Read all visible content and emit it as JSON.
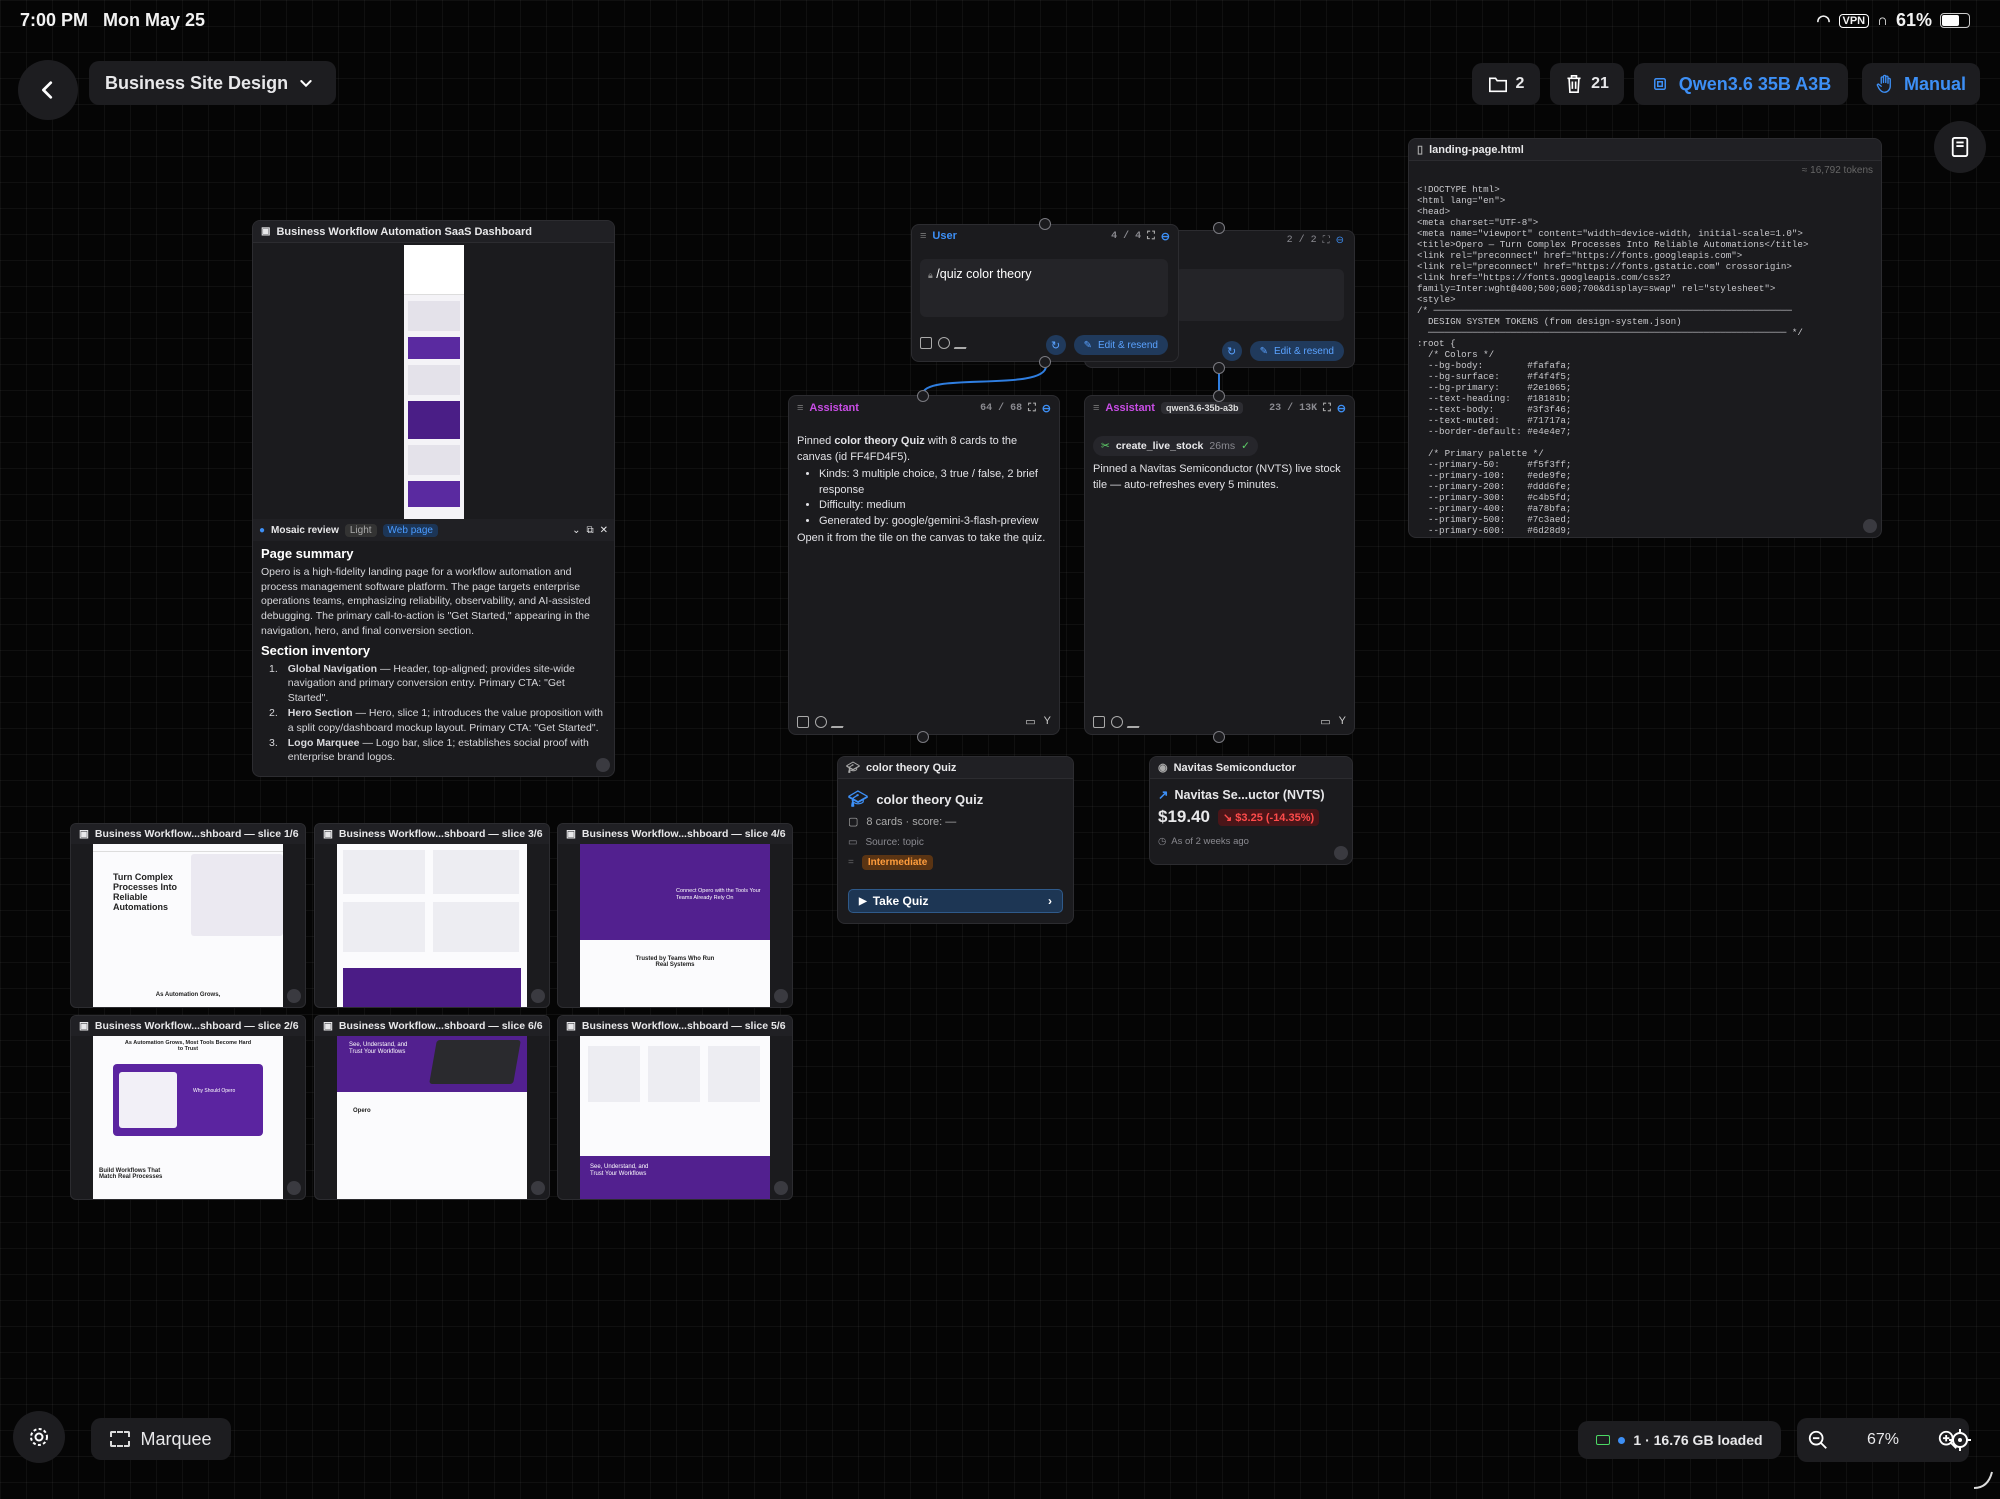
{
  "status": {
    "time": "7:00 PM",
    "date": "Mon May 25",
    "vpn": "VPN",
    "battery": "61%"
  },
  "topbar": {
    "project": "Business Site Design",
    "folders": "2",
    "trash": "21",
    "model": "Qwen3.6 35B A3B",
    "mode": "Manual"
  },
  "review": {
    "title": "Business Workflow Automation SaaS Dashboard",
    "badge": "Mosaic review",
    "tag1": "Light",
    "tag2": "Web page",
    "summary_h": "Page summary",
    "summary": "Opero is a high-fidelity landing page for a workflow automation and process management software platform. The page targets enterprise operations teams, emphasizing reliability, observability, and AI-assisted debugging. The primary call-to-action is \"Get Started,\" appearing in the navigation, hero, and final conversion section.",
    "inventory_h": "Section inventory",
    "items": [
      {
        "n": "1.",
        "b": "Global Navigation",
        "t": " — Header, top-aligned; provides site-wide navigation and primary conversion entry. Primary CTA: \"Get Started\"."
      },
      {
        "n": "2.",
        "b": "Hero Section",
        "t": " — Hero, slice 1; introduces the value proposition with a split copy/dashboard mockup layout. Primary CTA: \"Get Started\"."
      },
      {
        "n": "3.",
        "b": "Logo Marquee",
        "t": " — Logo bar, slice 1; establishes social proof with enterprise brand logos."
      }
    ]
  },
  "user_msg": {
    "role": "User",
    "count": "4 / 4",
    "text": "/quiz color theory",
    "edit": "Edit & resend",
    "count2": "2 / 2",
    "edit2": "Edit & resend"
  },
  "assistant1": {
    "role": "Assistant",
    "tokens": "64 / 68",
    "p1a": "Pinned ",
    "p1b": "color theory Quiz",
    "p1c": " with 8 cards to the canvas (id FF4FD4F5).",
    "bullets": [
      "Kinds: 3 multiple choice, 3 true / false, 2 brief response",
      "Difficulty: medium",
      "Generated by: google/gemini-3-flash-preview"
    ],
    "p2": "Open it from the tile on the canvas to take the quiz."
  },
  "assistant2": {
    "role": "Assistant",
    "model": "qwen3.6-35b-a3b",
    "tokens": "23 / 13K",
    "tool": "create_live_stock",
    "ms": "26ms",
    "text": "Pinned a Navitas Semiconductor (NVTS) live stock tile — auto-refreshes every 5 minutes."
  },
  "quiz": {
    "header": "color theory Quiz",
    "title": "color theory Quiz",
    "cards": "8 cards · score: —",
    "source": "Source: topic",
    "level": "Intermediate",
    "cta": "Take Quiz"
  },
  "stock": {
    "header": "Navitas Semiconductor",
    "name": "Navitas Se...uctor (NVTS)",
    "price": "$19.40",
    "change": "$3.25 (-14.35%)",
    "asof": "As of 2 weeks ago"
  },
  "code": {
    "file": "landing-page.html",
    "tokens": "≈ 16,792 tokens",
    "lines": [
      "<!DOCTYPE html>",
      "<html lang=\"en\">",
      "<head>",
      "<meta charset=\"UTF-8\">",
      "<meta name=\"viewport\" content=\"width=device-width, initial-scale=1.0\">",
      "<title>Opero — Turn Complex Processes Into Reliable Automations</title>",
      "<link rel=\"preconnect\" href=\"https://fonts.googleapis.com\">",
      "<link rel=\"preconnect\" href=\"https://fonts.gstatic.com\" crossorigin>",
      "<link href=\"https://fonts.googleapis.com/css2?",
      "family=Inter:wght@400;500;600;700&display=swap\" rel=\"stylesheet\">",
      "<style>",
      "/* ─────────────────────────────────────────────────────────────────",
      "  DESIGN SYSTEM TOKENS (from design-system.json)",
      "  ───────────────────────────────────────────────────────────────── */",
      ":root {",
      "  /* Colors */",
      "  --bg-body:        #fafafa;",
      "  --bg-surface:     #f4f4f5;",
      "  --bg-primary:     #2e1065;",
      "  --text-heading:   #18181b;",
      "  --text-body:      #3f3f46;",
      "  --text-muted:     #71717a;",
      "  --border-default: #e4e4e7;",
      "",
      "  /* Primary palette */",
      "  --primary-50:     #f5f3ff;",
      "  --primary-100:    #ede9fe;",
      "  --primary-200:    #ddd6fe;",
      "  --primary-300:    #c4b5fd;",
      "  --primary-400:    #a78bfa;",
      "  --primary-500:    #7c3aed;",
      "  --primary-600:    #6d28d9;"
    ]
  },
  "slices": [
    "Business Workflow...shboard — slice 1/6",
    "Business Workflow...shboard — slice 3/6",
    "Business Workflow...shboard — slice 4/6",
    "Business Workflow...shboard — slice 2/6",
    "Business Workflow...shboard — slice 6/6",
    "Business Workflow...shboard — slice 5/6"
  ],
  "slice_text": {
    "s1_hero": "Turn Complex Processes Into Reliable Automations",
    "s1_sub": "As Automation Grows,",
    "s2_h": "As Automation Grows, Most Tools Become Hard to Trust",
    "s2_why": "Why Should Opero",
    "s2_b": "Build Workflows That Match Real Processes",
    "s4_h": "Connect Opero with the Tools Your Teams Already Rely On",
    "s4_t": "Trusted by Teams Who Run Real Systems",
    "s5_h": "See, Understand, and Trust Your Workflows",
    "s6_h": "See, Understand, and Trust Your Workflows",
    "s6_logo": "Opero"
  },
  "bottom": {
    "marquee": "Marquee",
    "memory": "1 · 16.76 GB loaded",
    "zoom": "67%"
  }
}
